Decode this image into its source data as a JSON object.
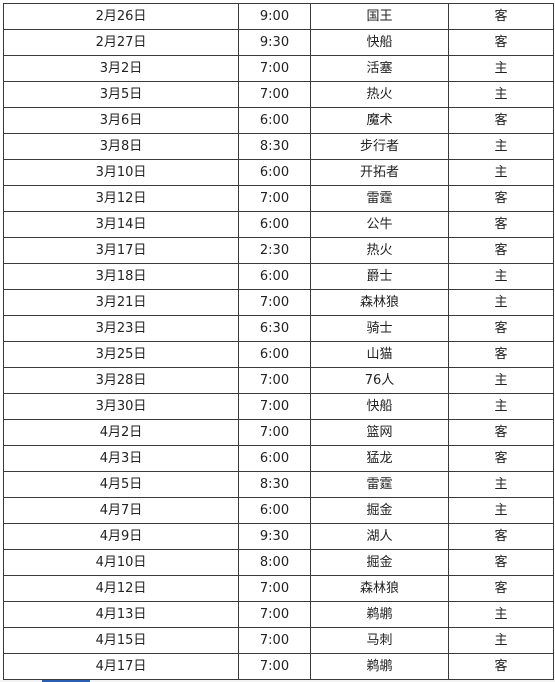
{
  "table": {
    "rows": [
      {
        "date": "2月26日",
        "time": "9:00",
        "opponent": "国王",
        "venue": "客"
      },
      {
        "date": "2月27日",
        "time": "9:30",
        "opponent": "快船",
        "venue": "客"
      },
      {
        "date": "3月2日",
        "time": "7:00",
        "opponent": "活塞",
        "venue": "主"
      },
      {
        "date": "3月5日",
        "time": "7:00",
        "opponent": "热火",
        "venue": "主"
      },
      {
        "date": "3月6日",
        "time": "6:00",
        "opponent": "魔术",
        "venue": "客"
      },
      {
        "date": "3月8日",
        "time": "8:30",
        "opponent": "步行者",
        "venue": "主"
      },
      {
        "date": "3月10日",
        "time": "6:00",
        "opponent": "开拓者",
        "venue": "主"
      },
      {
        "date": "3月12日",
        "time": "7:00",
        "opponent": "雷霆",
        "venue": "客"
      },
      {
        "date": "3月14日",
        "time": "6:00",
        "opponent": "公牛",
        "venue": "客"
      },
      {
        "date": "3月17日",
        "time": "2:30",
        "opponent": "热火",
        "venue": "客"
      },
      {
        "date": "3月18日",
        "time": "6:00",
        "opponent": "爵士",
        "venue": "主"
      },
      {
        "date": "3月21日",
        "time": "7:00",
        "opponent": "森林狼",
        "venue": "主"
      },
      {
        "date": "3月23日",
        "time": "6:30",
        "opponent": "骑士",
        "venue": "客"
      },
      {
        "date": "3月25日",
        "time": "6:00",
        "opponent": "山猫",
        "venue": "客"
      },
      {
        "date": "3月28日",
        "time": "7:00",
        "opponent": "76人",
        "venue": "主"
      },
      {
        "date": "3月30日",
        "time": "7:00",
        "opponent": "快船",
        "venue": "主"
      },
      {
        "date": "4月2日",
        "time": "7:00",
        "opponent": "篮网",
        "venue": "客"
      },
      {
        "date": "4月3日",
        "time": "6:00",
        "opponent": "猛龙",
        "venue": "客"
      },
      {
        "date": "4月5日",
        "time": "8:30",
        "opponent": "雷霆",
        "venue": "主"
      },
      {
        "date": "4月7日",
        "time": "6:00",
        "opponent": "掘金",
        "venue": "主"
      },
      {
        "date": "4月9日",
        "time": "9:30",
        "opponent": "湖人",
        "venue": "客"
      },
      {
        "date": "4月10日",
        "time": "8:00",
        "opponent": "掘金",
        "venue": "客"
      },
      {
        "date": "4月12日",
        "time": "7:00",
        "opponent": "森林狼",
        "venue": "客"
      },
      {
        "date": "4月13日",
        "time": "7:00",
        "opponent": "鹈鹕",
        "venue": "主"
      },
      {
        "date": "4月15日",
        "time": "7:00",
        "opponent": "马刺",
        "venue": "主"
      },
      {
        "date": "4月17日",
        "time": "7:00",
        "opponent": "鹈鹕",
        "venue": "客"
      }
    ]
  },
  "colors": {
    "border": "#3a3a3a",
    "text": "#222222",
    "background": "#ffffff",
    "link_accent": "#2b5fb3"
  }
}
